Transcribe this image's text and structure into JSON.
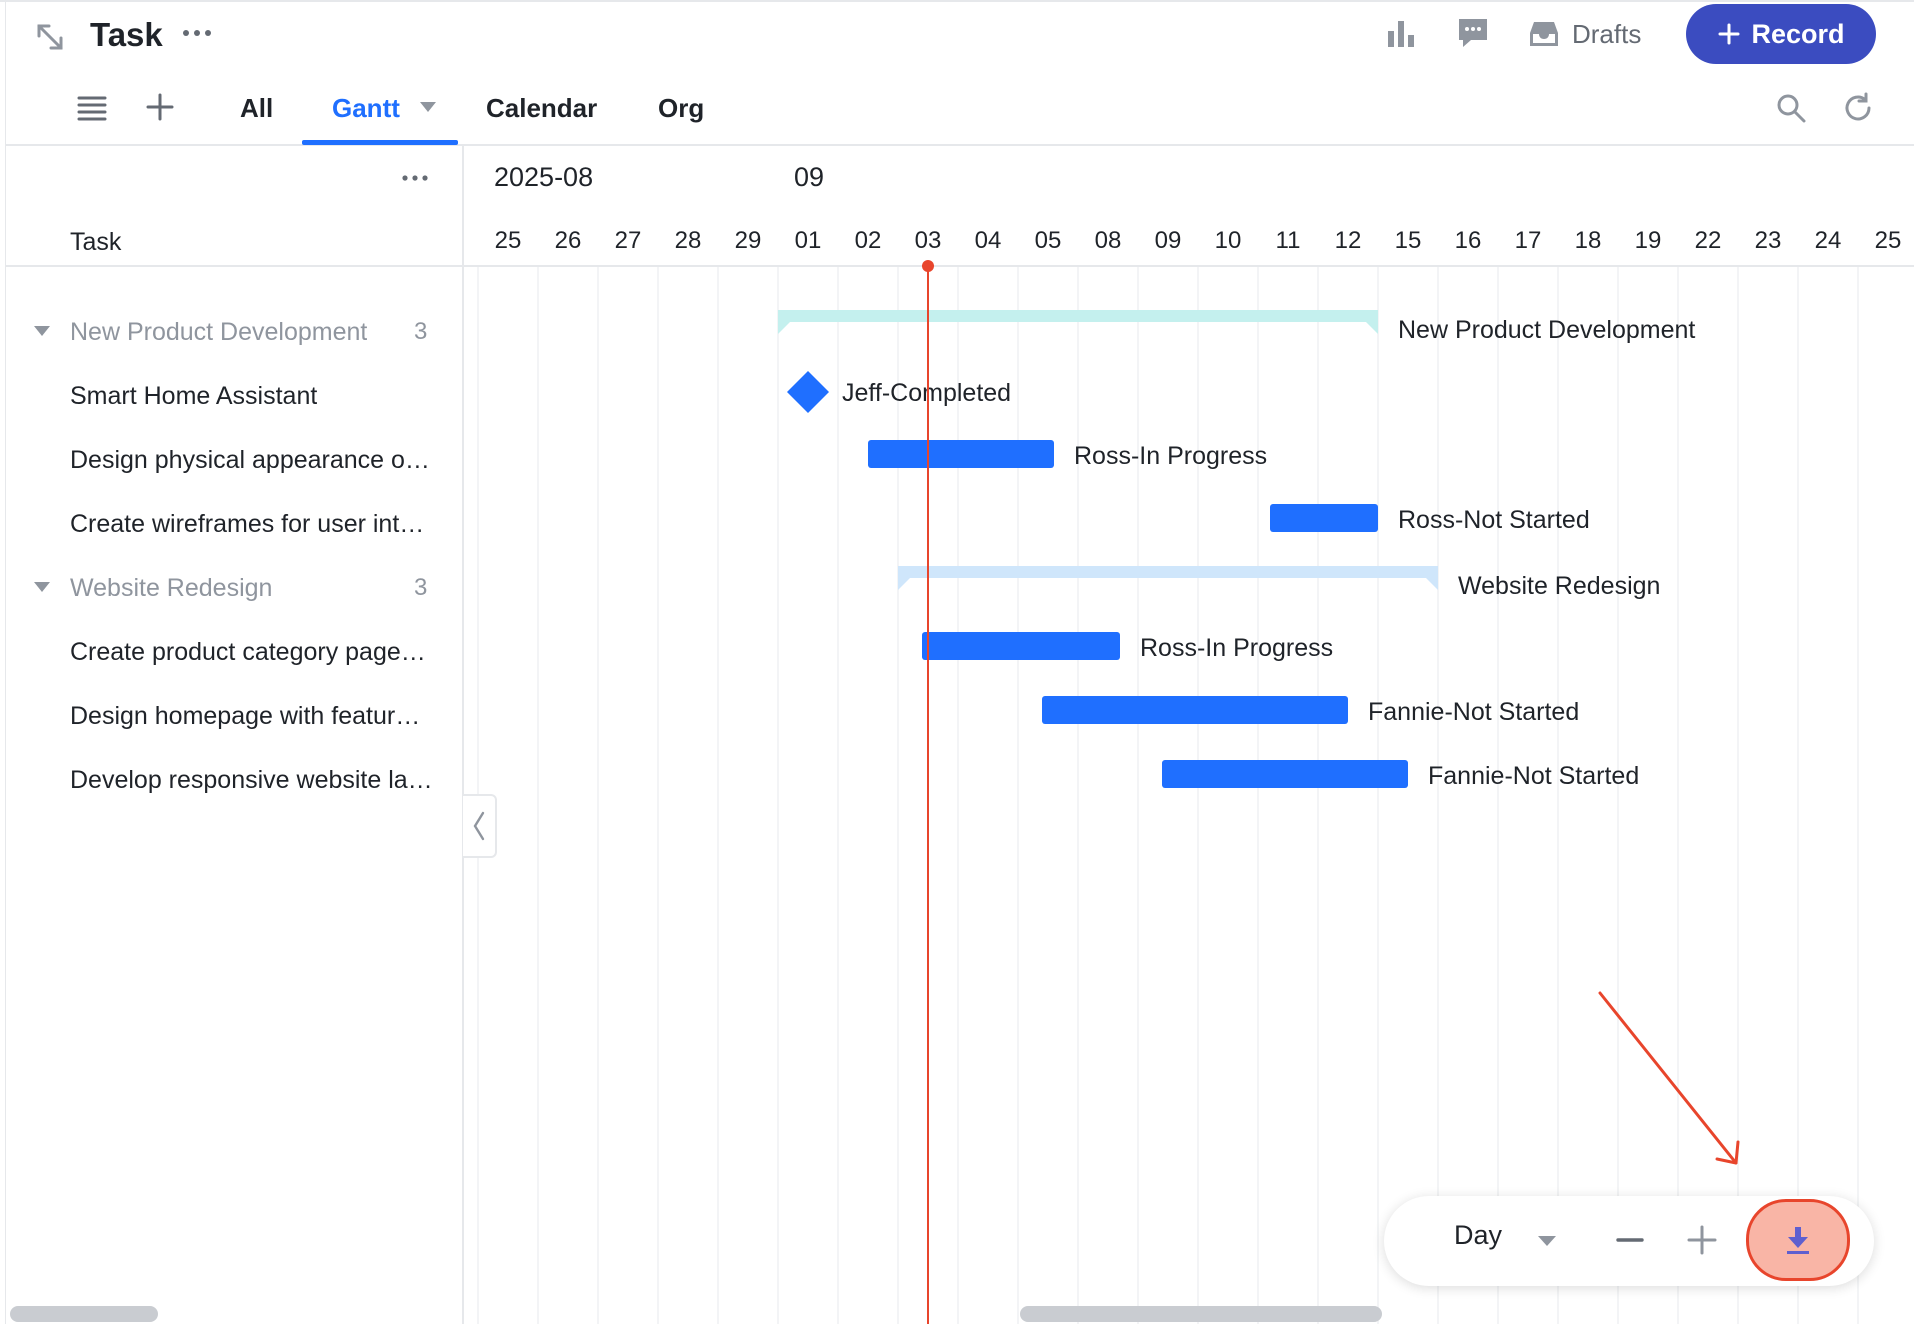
{
  "header": {
    "title": "Task",
    "drafts_label": "Drafts",
    "record_label": "Record"
  },
  "toolbar": {
    "tabs": [
      {
        "label": "All",
        "active": false
      },
      {
        "label": "Gantt",
        "active": true
      },
      {
        "label": "Calendar",
        "active": false
      },
      {
        "label": "Org",
        "active": false
      }
    ]
  },
  "task_panel": {
    "column_header": "Task",
    "rows": [
      {
        "kind": "group",
        "label": "New Product Development",
        "count": "3"
      },
      {
        "kind": "task",
        "label": "Smart Home Assistant"
      },
      {
        "kind": "task",
        "label": "Design physical appearance o…"
      },
      {
        "kind": "task",
        "label": "Create wireframes for user int…"
      },
      {
        "kind": "group",
        "label": "Website Redesign",
        "count": "3"
      },
      {
        "kind": "task",
        "label": "Create product category page…"
      },
      {
        "kind": "task",
        "label": "Design homepage with featur…"
      },
      {
        "kind": "task",
        "label": "Develop responsive website la…"
      }
    ]
  },
  "timeline": {
    "month_labels": [
      {
        "label": "2025-08",
        "day_index": 0
      },
      {
        "label": "09",
        "day_index": 5
      }
    ],
    "days": [
      "25",
      "26",
      "27",
      "28",
      "29",
      "01",
      "02",
      "03",
      "04",
      "05",
      "08",
      "09",
      "10",
      "11",
      "12",
      "15",
      "16",
      "17",
      "18",
      "19",
      "22",
      "23",
      "24",
      "25"
    ],
    "today_index": 7,
    "colors": {
      "task_bar": "#1f6fff",
      "group_bar_1": "#c4f0ee",
      "group_bar_2": "#cfe6fb",
      "today_line": "#e8452c",
      "grid_line": "#eef0f2"
    },
    "bars": [
      {
        "row": 0,
        "kind": "group",
        "start": 5,
        "end": 15,
        "color_key": "group_bar_1",
        "label": "New Product Development"
      },
      {
        "row": 1,
        "kind": "milestone",
        "start": 5,
        "end": 5,
        "label": "Jeff-Completed"
      },
      {
        "row": 2,
        "kind": "task",
        "start": 6.5,
        "end": 9.6,
        "label": "Ross-In Progress"
      },
      {
        "row": 3,
        "kind": "task",
        "start": 13.2,
        "end": 15,
        "label": "Ross-Not Started"
      },
      {
        "row": 4,
        "kind": "group",
        "start": 7,
        "end": 16,
        "color_key": "group_bar_2",
        "label": "Website Redesign"
      },
      {
        "row": 5,
        "kind": "task",
        "start": 7.4,
        "end": 10.7,
        "label": "Ross-In Progress"
      },
      {
        "row": 6,
        "kind": "task",
        "start": 9.4,
        "end": 14.5,
        "label": "Fannie-Not Started"
      },
      {
        "row": 7,
        "kind": "task",
        "start": 11.4,
        "end": 15.5,
        "label": "Fannie-Not Started"
      }
    ]
  },
  "bottom_bar": {
    "scale_label": "Day"
  },
  "icons": {
    "expand": "expand-diagonal-icon",
    "more": "more-horizontal-icon",
    "chart": "bar-chart-icon",
    "comment": "comment-icon",
    "drafts": "inbox-icon",
    "list": "list-icon",
    "add": "plus-icon",
    "search": "search-icon",
    "refresh": "refresh-icon",
    "export": "download-icon"
  }
}
